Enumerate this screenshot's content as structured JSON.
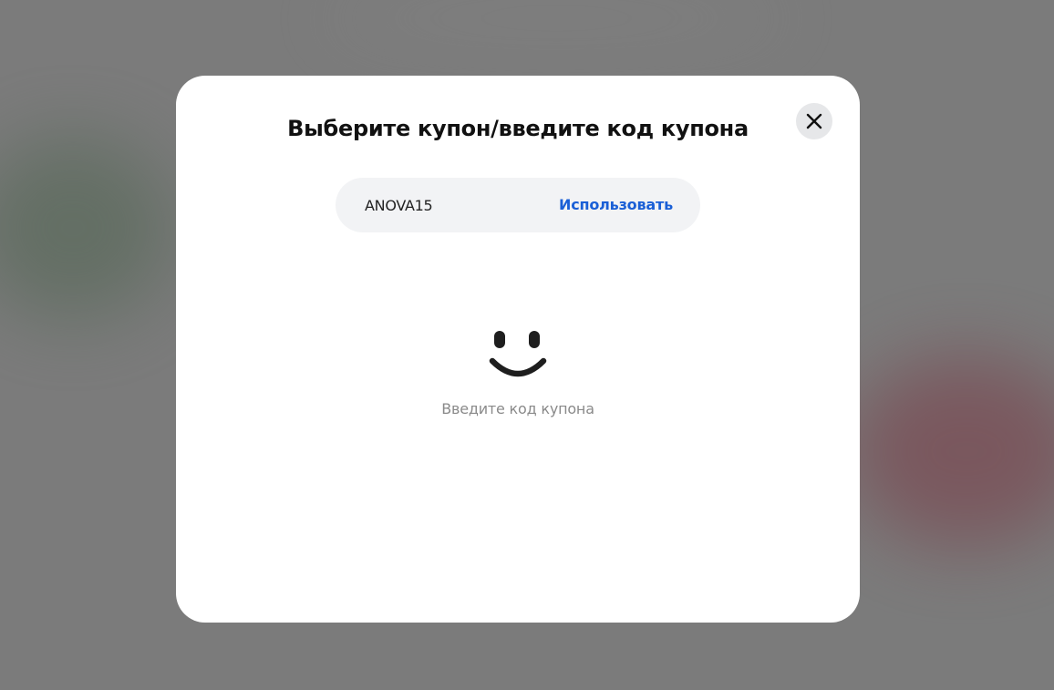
{
  "modal": {
    "title": "Выберите купон/введите код купона",
    "close_icon": "close-icon"
  },
  "coupon": {
    "value": "ANOVA15",
    "apply_label": "Использовать"
  },
  "empty_state": {
    "icon": "smile-icon",
    "text": "Введите код купона"
  },
  "colors": {
    "backdrop": "#7b7b7b",
    "modal_bg": "#ffffff",
    "input_bg": "#f2f3f5",
    "accent": "#1a5fd6",
    "muted_text": "#8a8a8a"
  }
}
